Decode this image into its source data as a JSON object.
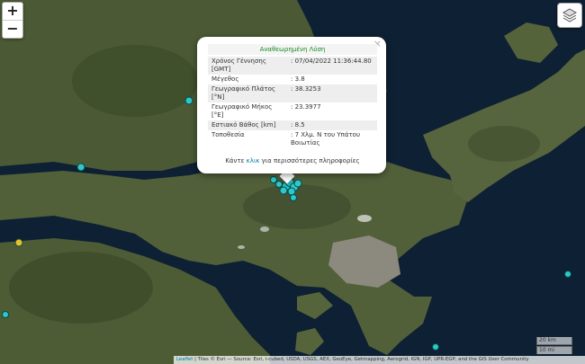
{
  "zoom": {
    "in_label": "+",
    "out_label": "−"
  },
  "layers_control": {
    "icon": "layers-icon"
  },
  "popup": {
    "title": "Αναθεωρημένη Λύση",
    "close_label": "×",
    "rows": [
      {
        "label": "Χρόνος Γέννησης [GMT]",
        "value": ": 07/04/2022 11:36:44.80"
      },
      {
        "label": "Μέγεθος",
        "value": ": 3.8"
      },
      {
        "label": "Γεωγραφικό Πλάτος [°N]",
        "value": ": 38.3253"
      },
      {
        "label": "Γεωγραφικό Μήκος [°E]",
        "value": ": 23.3977"
      },
      {
        "label": "Εστιακό Βάθος [km]",
        "value": ": 8.5"
      },
      {
        "label": "Τοποθεσία",
        "value": ": 7 Χλμ. Ν του Υπάτου Βοιωτίας"
      }
    ],
    "more_prefix": "Κάντε ",
    "more_link": "κλικ",
    "more_suffix": " για περισσότερες πληροφορίες"
  },
  "scale": {
    "metric": "20 km",
    "imperial": "10 mi"
  },
  "attribution": {
    "link": "Leaflet",
    "text": " | Tiles © Esri — Source: Esri, i-cubed, USDA, USGS, AEX, GeoEye, Getmapping, Aerogrid, IGN, IGP, UPR-EGP, and the GIS User Community"
  },
  "colors": {
    "sea": "#0e2033",
    "land": "#4b5a34",
    "marker_cyan": "#2fc7c9",
    "marker_yellow": "#e6c12c",
    "title_green": "#178a21",
    "link_blue": "#0078a8"
  }
}
